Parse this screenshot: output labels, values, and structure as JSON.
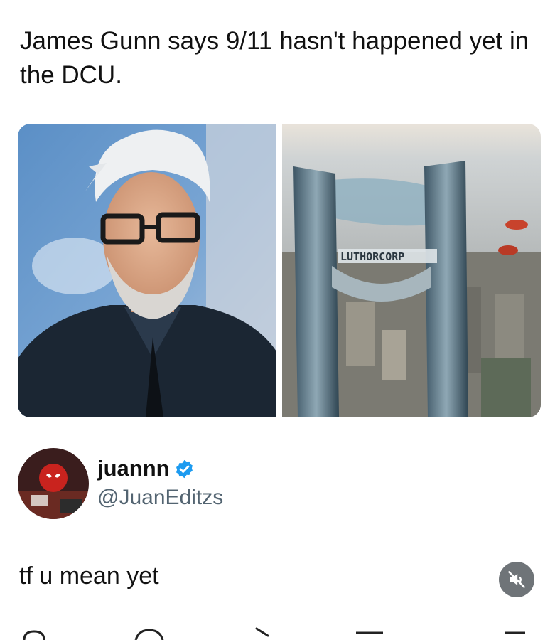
{
  "post": {
    "headline": "James Gunn says 9/11 hasn't happened yet in the DCU."
  },
  "media": {
    "right_image_sign": "LUTHORCORP"
  },
  "tweet": {
    "display_name": "juannn",
    "handle": "@JuanEditzs",
    "text": "tf u mean yet",
    "verified": true
  },
  "icons": {
    "verified": "verified-badge-icon",
    "mute": "speaker-muted-icon",
    "reply": "reply-icon",
    "retweet": "retweet-icon",
    "like": "like-icon",
    "bookmark": "bookmark-icon",
    "share": "share-icon"
  },
  "colors": {
    "verified_blue": "#1d9bf0",
    "handle_gray": "#536471",
    "mute_bg": "#6f7478"
  }
}
